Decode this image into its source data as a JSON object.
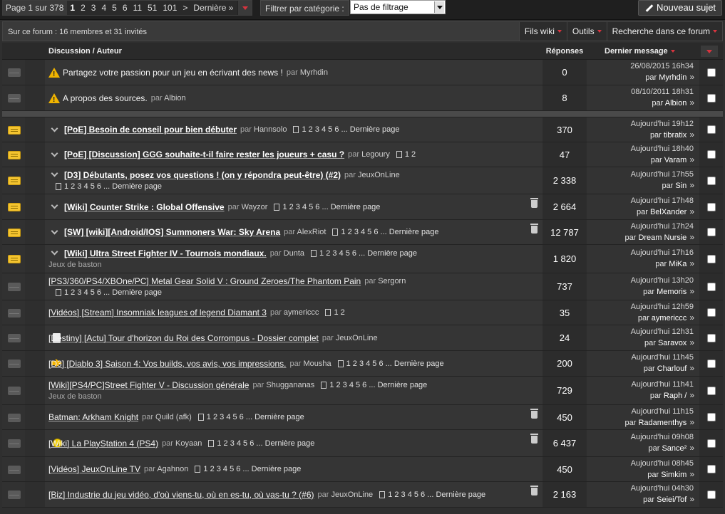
{
  "pager": {
    "label": "Page 1 sur 378",
    "current": "1",
    "pages": [
      "2",
      "3",
      "4",
      "5",
      "6",
      "11",
      "51",
      "101"
    ],
    "next": ">",
    "last": "Dernière »"
  },
  "filter": {
    "label": "Filtrer par catégorie :",
    "value": "Pas de filtrage"
  },
  "new_topic_label": "Nouveau sujet",
  "online_text": "Sur ce forum : 16 membres et 31 invités",
  "tools": [
    "Fils wiki",
    "Outils",
    "Recherche dans ce forum"
  ],
  "headers": {
    "discussion": "Discussion / Auteur",
    "replies": "Réponses",
    "last": "Dernier message"
  },
  "colors": {
    "accent": "#d8343f",
    "hot_icon": "#f4c430"
  },
  "pinned": [
    {
      "title": "Partagez votre passion pour un jeu en écrivant des news !",
      "author": "Myrhdin",
      "replies": "0",
      "date": "26/08/2015 16h34",
      "last_by": "Myrhdin",
      "by_label": "par",
      "icon": "warning-icon"
    },
    {
      "title": "A propos des sources.",
      "author": "Albion",
      "replies": "8",
      "date": "08/10/2011 18h31",
      "last_by": "Albion",
      "by_label": "par",
      "icon": "warning-icon"
    }
  ],
  "par": "par",
  "page_list": "1 2 3 4 5 6 ... Dernière page",
  "topics": [
    {
      "title": "[PoE] Besoin de conseil pour bien débuter",
      "author": "Hannsolo",
      "pages": "1 2 3 4 5 6 ... Dernière page",
      "replies": "370",
      "date": "Aujourd'hui 19h12",
      "last_by": "tibratix",
      "hot": true
    },
    {
      "title": "[PoE] [Discussion] GGG souhaite-t-il faire rester les joueurs + casu ?",
      "author": "Legoury",
      "pages": "1 2",
      "replies": "47",
      "date": "Aujourd'hui 18h40",
      "last_by": "Varam",
      "hot": true
    },
    {
      "title": "[D3] Débutants, posez vos questions ! (on y répondra peut-être) (#2)",
      "author": "JeuxOnLine",
      "pages": "1 2 3 4 5 6 ... Dernière page",
      "replies": "2 338",
      "date": "Aujourd'hui 17h55",
      "last_by": "Sin",
      "hot": true
    },
    {
      "title": "[Wiki] Counter Strike : Global Offensive",
      "author": "Wayzor",
      "pages": "1 2 3 4 5 6 ... Dernière page",
      "replies": "2 664",
      "date": "Aujourd'hui 17h48",
      "last_by": "BelXander",
      "hot": true
    },
    {
      "title": "[SW] [wiki][Android/IOS] Summoners War: Sky Arena",
      "author": "AlexRiot",
      "pages": "1 2 3 4 5 6 ... Dernière page",
      "replies": "12 787",
      "date": "Aujourd'hui 17h24",
      "last_by": "Dream Nursie",
      "hot": true
    },
    {
      "title": "[Wiki] Ultra Street Fighter IV - Tournois mondiaux.",
      "author": "Dunta",
      "pages": "1 2 3 4 5 6 ... Dernière page",
      "category": "Jeux de baston",
      "replies": "1 820",
      "date": "Aujourd'hui 17h16",
      "last_by": "MiKa",
      "hot": true
    },
    {
      "title": "[PS3/360/PS4/XBOne/PC] Metal Gear Solid V : Ground Zeroes/The Phantom Pain",
      "author": "Sergorn",
      "pages": "1 2 3 4 5 6 ... Dernière page",
      "replies": "737",
      "date": "Aujourd'hui 13h20",
      "last_by": "Memoris"
    },
    {
      "title": "[Vidéos] [Stream] Insomniak leagues of legend Diamant 3",
      "author": "aymericcc",
      "pages": "1 2",
      "replies": "35",
      "date": "Aujourd'hui 12h59",
      "last_by": "aymericcc"
    },
    {
      "title": "[Destiny] [Actu] Tour d'horizon du Roi des Corrompus - Dossier complet",
      "author": "JeuxOnLine",
      "replies": "24",
      "date": "Aujourd'hui 12h31",
      "last_by": "Saravox"
    },
    {
      "title": "[D3] [Diablo 3] Saison 4: Vos builds, vos avis, vos impressions.",
      "author": "Mousha",
      "pages": "1 2 3 4 5 6 ... Dernière page",
      "replies": "200",
      "date": "Aujourd'hui 11h45",
      "last_by": "Charlouf"
    },
    {
      "title": "[Wiki][PS4/PC]Street Fighter V - Discussion générale",
      "author": "Shuggananas",
      "pages": "1 2 3 4 5 6 ... Dernière page",
      "category": "Jeux de baston",
      "replies": "729",
      "date": "Aujourd'hui 11h41",
      "last_by": "Raph /"
    },
    {
      "title": "Batman: Arkham Knight",
      "author": "Quild (afk)",
      "pages": "1 2 3 4 5 6 ... Dernière page",
      "replies": "450",
      "date": "Aujourd'hui 11h15",
      "last_by": "Radamenthys"
    },
    {
      "title": "[Wiki] La PlayStation 4 (PS4)",
      "author": "Koyaan",
      "pages": "1 2 3 4 5 6 ... Dernière page",
      "replies": "6 437",
      "date": "Aujourd'hui 09h08",
      "last_by": "Sance²"
    },
    {
      "title": "[Vidéos] JeuxOnLine TV",
      "author": "Agahnon",
      "pages": "1 2 3 4 5 6 ... Dernière page",
      "replies": "450",
      "date": "Aujourd'hui 08h45",
      "last_by": "Simkim"
    },
    {
      "title": "[Biz] Industrie du jeu vidéo, d'où viens-tu, où en es-tu, où vas-tu ? (#6)",
      "author": "JeuxOnLine",
      "pages": "1 2 3 4 5 6 ... Dernière page",
      "replies": "2 163",
      "date": "Aujourd'hui 04h30",
      "last_by": "Seiei/Tof"
    }
  ]
}
